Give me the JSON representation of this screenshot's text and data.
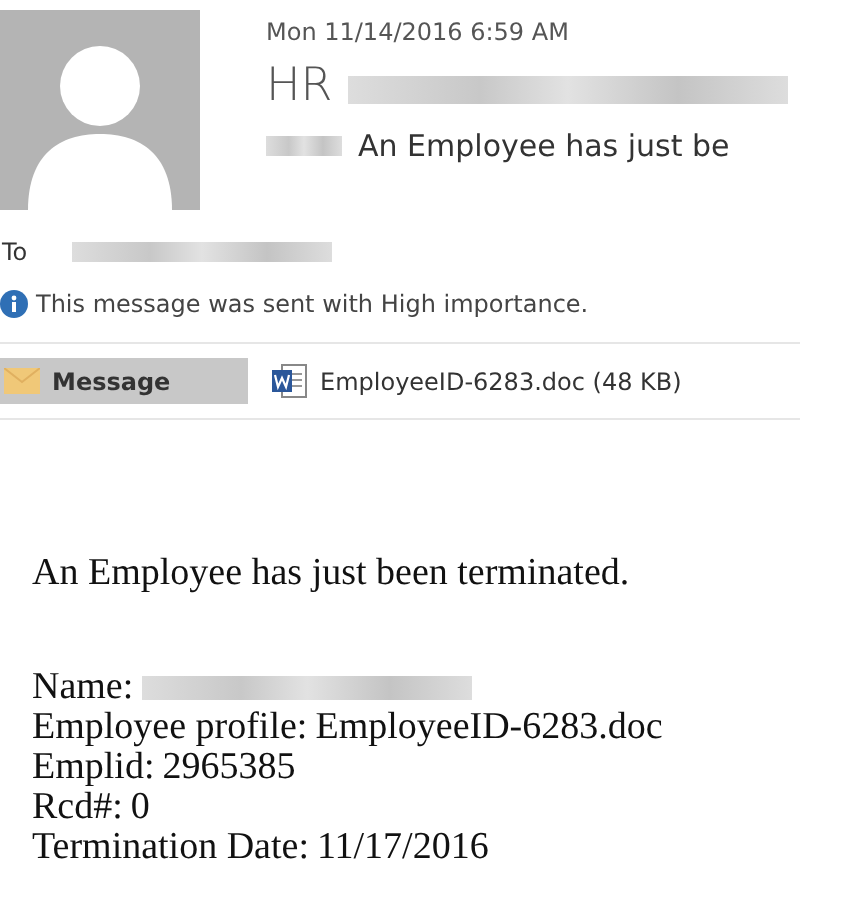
{
  "header": {
    "date": "Mon 11/14/2016 6:59 AM",
    "sender": "HR",
    "subject": "An Employee has just be",
    "to_label": "To",
    "importance_notice": "This message was sent with High importance."
  },
  "tabs": [
    {
      "kind": "message",
      "label": "Message",
      "selected": true
    },
    {
      "kind": "attachment",
      "label": "EmployeeID-6283.doc (48 KB)",
      "selected": false
    }
  ],
  "body": {
    "intro": "An Employee has just been terminated.",
    "fields": [
      {
        "label": "Name:"
      },
      {
        "label": "Employee profile:",
        "value": "EmployeeID-6283.doc"
      },
      {
        "label": "Emplid:",
        "value": "2965385"
      },
      {
        "label": "Rcd#:",
        "value": "0"
      },
      {
        "label": "Termination Date:",
        "value": "11/17/2016"
      }
    ]
  }
}
